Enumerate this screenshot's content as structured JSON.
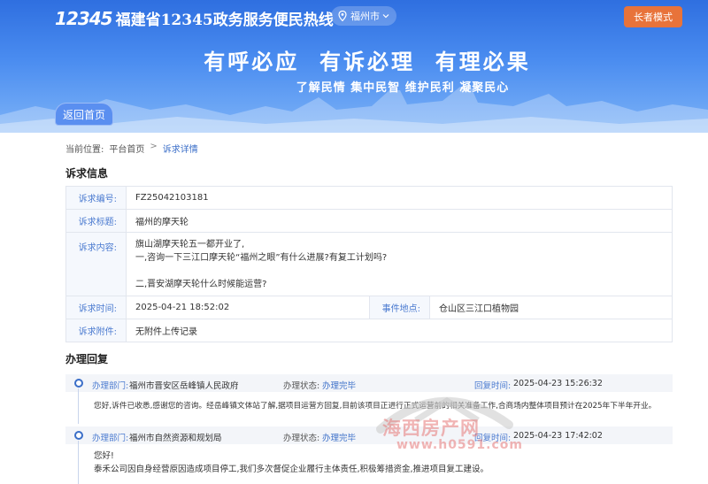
{
  "header": {
    "logo_number": "12345",
    "site_title": "福建省12345政务服务便民热线",
    "city": "福州市",
    "elder_mode": "长者模式",
    "slogan_main": "有呼必应  有诉必理  有理必果",
    "slogan_sub": "了解民情 集中民智 维护民利 凝聚民心",
    "back_home": "返回首页"
  },
  "breadcrumb": {
    "label": "当前位置:",
    "home": "平台首页",
    "sep": ">",
    "current": "诉求详情"
  },
  "appeal": {
    "section_title": "诉求信息",
    "number_label": "诉求编号:",
    "number": "FZ25042103181",
    "title_label": "诉求标题:",
    "title": "福州的摩天轮",
    "content_label": "诉求内容:",
    "content_lines": [
      "旗山湖摩天轮五一都开业了,",
      "一,咨询一下三江口摩天轮“福州之眼”有什么进展?有复工计划吗?",
      "",
      "二,晋安湖摩天轮什么时候能运营?"
    ],
    "time_label": "诉求时间:",
    "time": "2025-04-21 18:52:02",
    "location_label": "事件地点:",
    "location": "仓山区三江口植物园",
    "attachment_label": "诉求附件:",
    "attachment": "无附件上传记录"
  },
  "replies": {
    "section_title": "办理回复",
    "items": [
      {
        "dept_label": "办理部门:",
        "dept": "福州市晋安区岳峰镇人民政府",
        "status_label": "办理状态:",
        "status": "办理完毕",
        "time_label": "回复时间:",
        "time": "2025-04-23 15:26:32",
        "body": [
          "您好,诉件已收悉,感谢您的咨询。经岳峰镇文体站了解,据项目运营方回复,目前该项目正进行正式运营前的相关准备工作,合商场内整体项目预计在2025年下半年开业。"
        ]
      },
      {
        "dept_label": "办理部门:",
        "dept": "福州市自然资源和规划局",
        "status_label": "办理状态:",
        "status": "办理完毕",
        "time_label": "回复时间:",
        "time": "2025-04-23 17:42:02",
        "body": [
          "您好!",
          "泰禾公司因自身经营原因造成项目停工,我们多次督促企业履行主体责任,积极筹措资金,推进项目复工建设。"
        ]
      }
    ]
  },
  "watermark": {
    "text": "海西房产网",
    "url": "www.h0591.com"
  },
  "colors": {
    "banner": "#2f6fe0",
    "accent": "#3a6ec8",
    "elder_button": "#e8733a",
    "label_bg": "#f5f8fd"
  }
}
